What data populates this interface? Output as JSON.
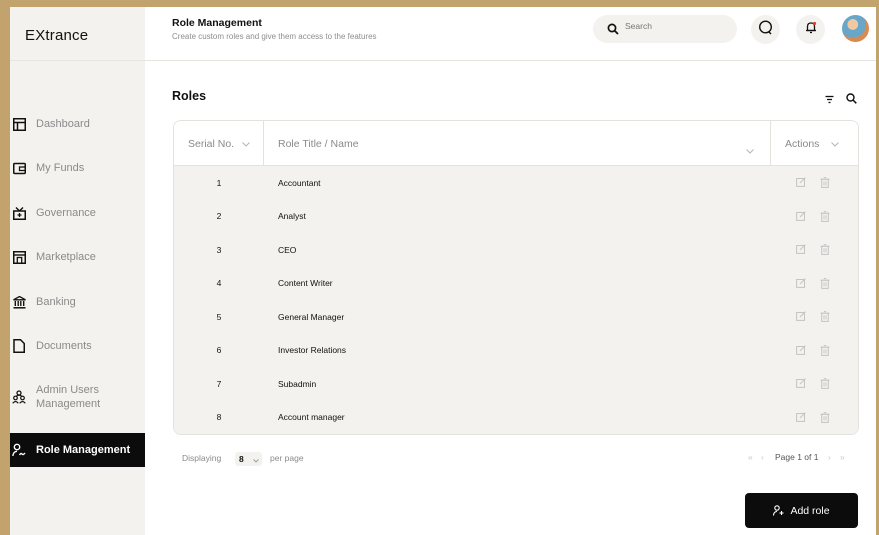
{
  "app": {
    "logo": "EXtrance"
  },
  "sidebar": {
    "items": [
      {
        "label": "Dashboard",
        "icon": "dashboard-icon"
      },
      {
        "label": "My Funds",
        "icon": "wallet-icon"
      },
      {
        "label": "Governance",
        "icon": "governance-icon"
      },
      {
        "label": "Marketplace",
        "icon": "store-icon"
      },
      {
        "label": "Banking",
        "icon": "bank-icon"
      },
      {
        "label": "Documents",
        "icon": "document-icon"
      },
      {
        "label": "Admin Users Management",
        "icon": "users-icon"
      },
      {
        "label": "Role Management",
        "icon": "role-icon",
        "active": true
      }
    ]
  },
  "header": {
    "title": "Role Management",
    "subtitle": "Create custom roles and give them access to the features",
    "search_placeholder": "Search"
  },
  "section": {
    "title": "Roles"
  },
  "table": {
    "columns": [
      "Serial No.",
      "Role Title / Name",
      "Actions"
    ],
    "rows": [
      {
        "serial": "1",
        "name": "Accountant"
      },
      {
        "serial": "2",
        "name": "Analyst"
      },
      {
        "serial": "3",
        "name": "CEO"
      },
      {
        "serial": "4",
        "name": "Content Writer"
      },
      {
        "serial": "5",
        "name": "General Manager"
      },
      {
        "serial": "6",
        "name": "Investor Relations"
      },
      {
        "serial": "7",
        "name": "Subadmin"
      },
      {
        "serial": "8",
        "name": "Account manager"
      }
    ]
  },
  "footer": {
    "displaying": "Displaying",
    "per_page_value": "8",
    "per_page": "per page",
    "page_text": "Page 1 of 1"
  },
  "actions": {
    "add_role": "Add role"
  },
  "colors": {
    "accent": "#0c0c0c",
    "sidebar_bg": "#f3f2ef",
    "frame_border": "#c2a36e"
  }
}
